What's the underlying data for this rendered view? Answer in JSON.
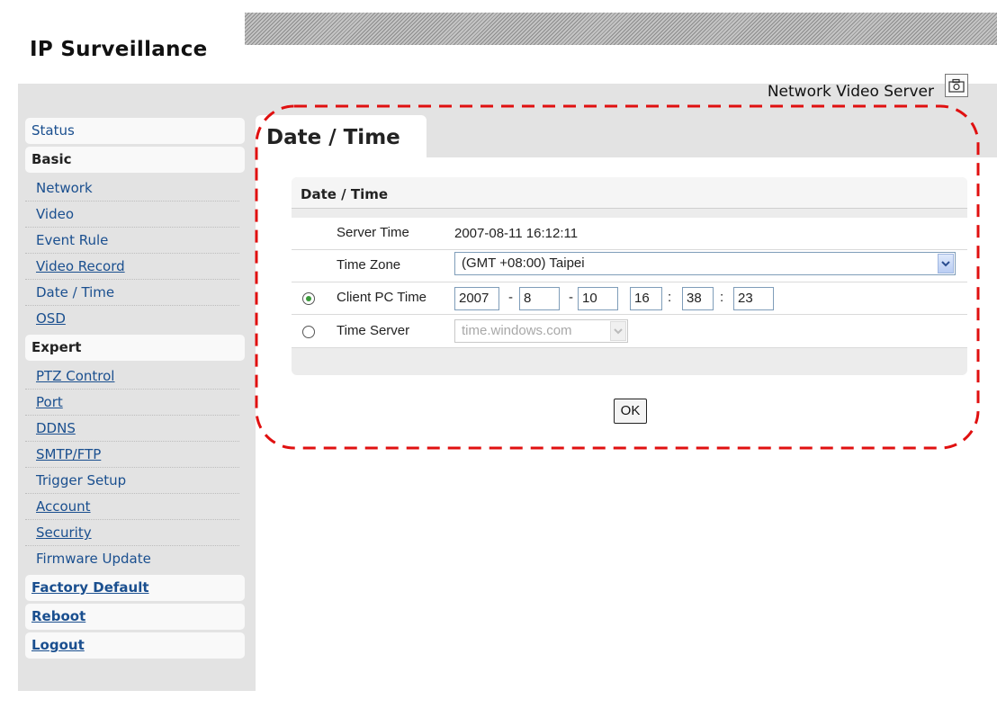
{
  "header": {
    "brand": "IP Surveillance",
    "product": "Network Video Server",
    "product_icon": "camera-icon"
  },
  "page": {
    "title": "Date / Time"
  },
  "sidebar": {
    "status": "Status",
    "basic": {
      "label": "Basic",
      "items": [
        "Network",
        "Video",
        "Event Rule",
        "Video Record",
        "Date / Time",
        "OSD"
      ]
    },
    "expert": {
      "label": "Expert",
      "items": [
        "PTZ Control",
        "Port",
        "DDNS",
        "SMTP/FTP",
        "Trigger Setup",
        "Account",
        "Security",
        "Firmware Update"
      ]
    },
    "factory_default": "Factory Default",
    "reboot": "Reboot",
    "logout": "Logout"
  },
  "form": {
    "section_title": "Date / Time",
    "server_time": {
      "label": "Server Time",
      "value": "2007-08-11 16:12:11"
    },
    "time_zone": {
      "label": "Time Zone",
      "value": "(GMT +08:00) Taipei"
    },
    "client_pc_time": {
      "label": "Client PC Time",
      "selected": true,
      "year": "2007",
      "month": "8",
      "day": "10",
      "hour": "16",
      "minute": "38",
      "second": "23",
      "date_sep": "-",
      "time_sep": ":"
    },
    "time_server": {
      "label": "Time Server",
      "selected": false,
      "value": "time.windows.com"
    },
    "ok_label": "OK"
  },
  "colors": {
    "link": "#1a4f8f",
    "panel_gray": "#e3e3e3",
    "annotation_red": "#e01010",
    "radio_on": "#3a9a3a"
  }
}
